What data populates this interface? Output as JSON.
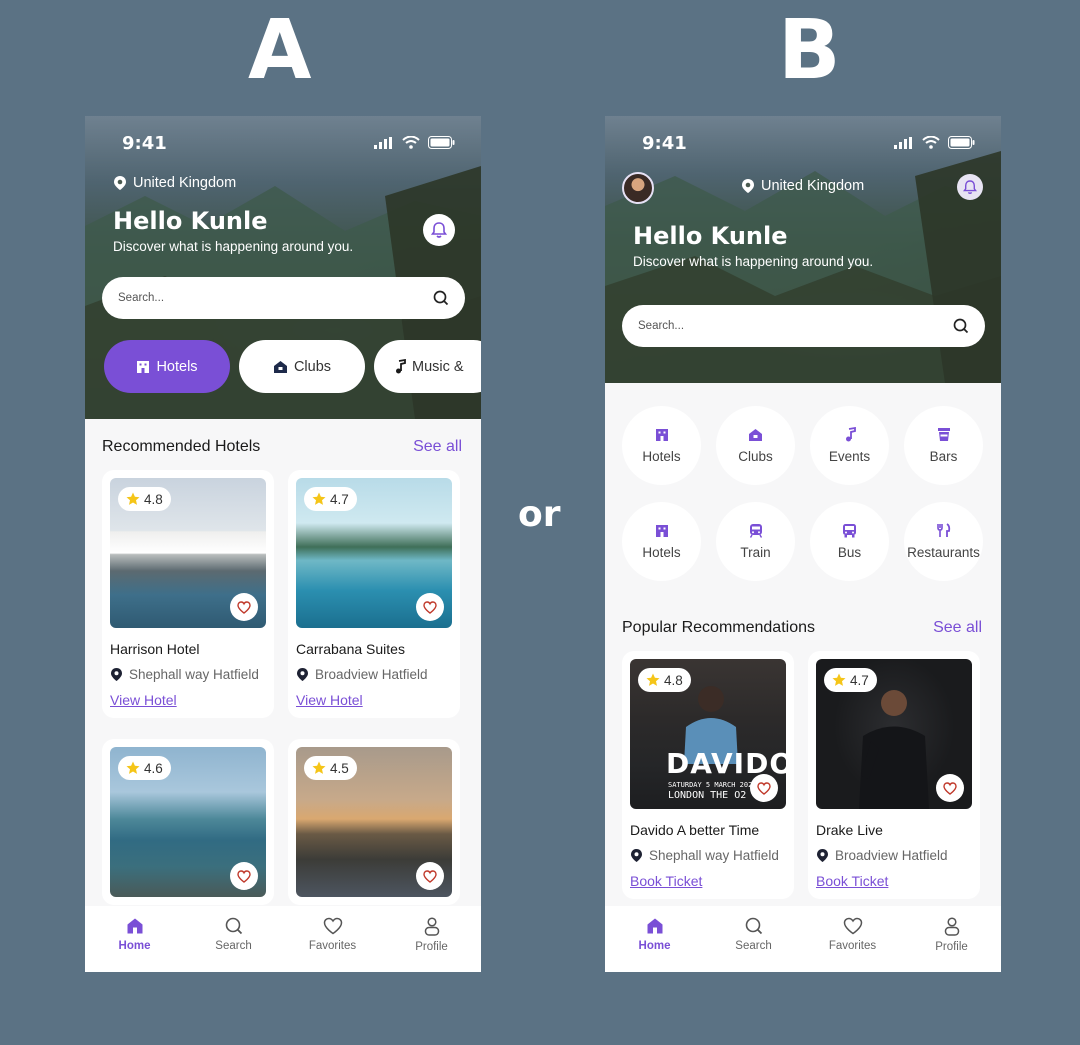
{
  "labels": {
    "variant_a": "A",
    "variant_b": "B",
    "or": "or"
  },
  "colors": {
    "accent": "#7a4fd6",
    "background": "#5b7284",
    "star": "#f5c518",
    "heart": "#c0392b"
  },
  "phone_a": {
    "status_time": "9:41",
    "location": "United Kingdom",
    "greeting": "Hello Kunle",
    "subtitle": "Discover what is happening around you.",
    "search_placeholder": "Search...",
    "chips": [
      "Hotels",
      "Clubs",
      "Music &"
    ],
    "section_title": "Recommended Hotels",
    "see_all": "See all",
    "cards": [
      {
        "rating": "4.8",
        "name": "Harrison Hotel",
        "location": "Shephall way Hatfield",
        "link": "View Hotel"
      },
      {
        "rating": "4.7",
        "name": "Carrabana Suites",
        "location": "Broadview Hatfield",
        "link": "View Hotel"
      },
      {
        "rating": "4.6"
      },
      {
        "rating": "4.5"
      }
    ],
    "tabs": [
      "Home",
      "Search",
      "Favorites",
      "Profile"
    ]
  },
  "phone_b": {
    "status_time": "9:41",
    "location": "United Kingdom",
    "greeting": "Hello Kunle",
    "subtitle": "Discover what is happening around you.",
    "search_placeholder": "Search...",
    "categories": [
      "Hotels",
      "Clubs",
      "Events",
      "Bars",
      "Hotels",
      "Train",
      "Bus",
      "Restaurants"
    ],
    "section_title": "Popular Recommendations",
    "see_all": "See all",
    "cards": [
      {
        "rating": "4.8",
        "name": "Davido A better Time",
        "location": "Shephall way Hatfield",
        "link": "Book Ticket",
        "poster_title": "DAVIDO",
        "poster_line1": "SATURDAY 5 MARCH 2022",
        "poster_line2": "LONDON THE O2"
      },
      {
        "rating": "4.7",
        "name": "Drake Live",
        "location": "Broadview Hatfield",
        "link": "Book Ticket"
      }
    ],
    "tabs": [
      "Home",
      "Search",
      "Favorites",
      "Profile"
    ]
  }
}
